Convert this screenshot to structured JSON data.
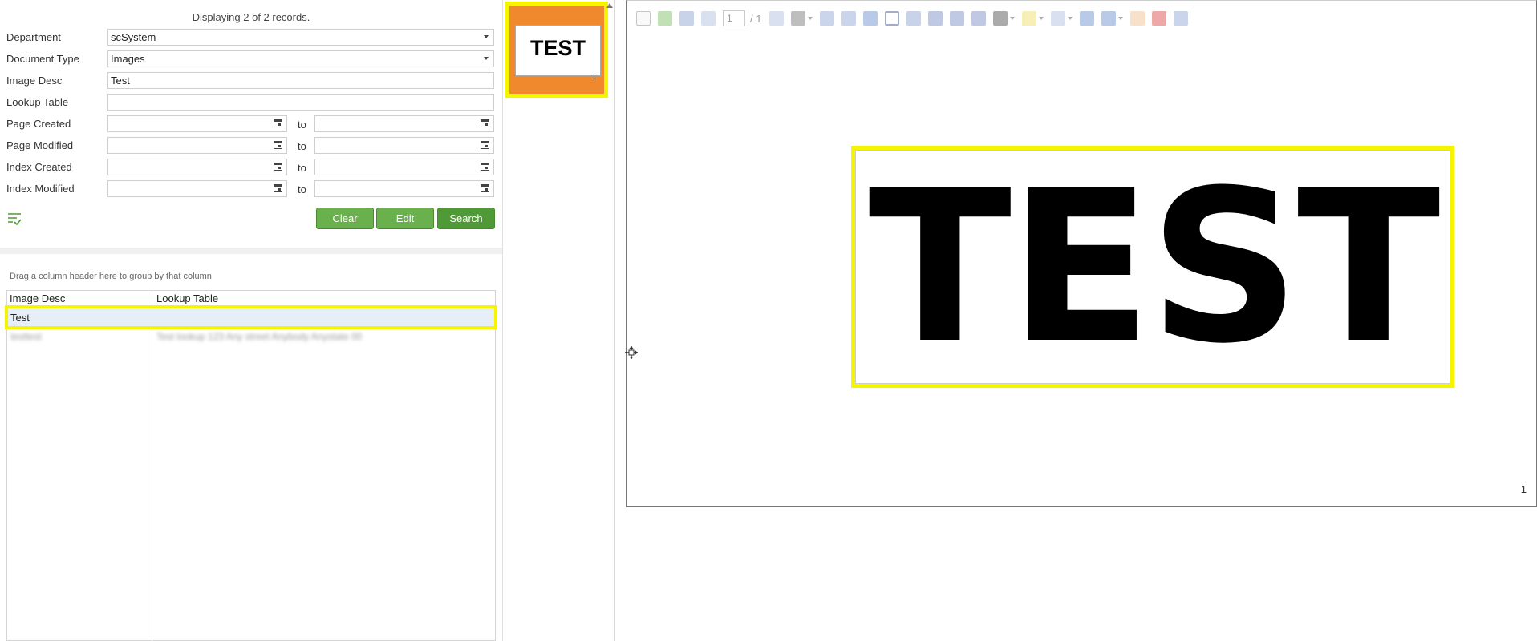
{
  "search": {
    "record_count": "Displaying 2 of 2 records.",
    "fields": {
      "department": {
        "label": "Department",
        "value": "scSystem"
      },
      "document_type": {
        "label": "Document Type",
        "value": "Images"
      },
      "image_desc": {
        "label": "Image Desc",
        "value": "Test"
      },
      "lookup_table": {
        "label": "Lookup Table",
        "value": ""
      },
      "page_created": {
        "label": "Page Created",
        "to": "to"
      },
      "page_modified": {
        "label": "Page Modified",
        "to": "to"
      },
      "index_created": {
        "label": "Index Created",
        "to": "to"
      },
      "index_modified": {
        "label": "Index Modified",
        "to": "to"
      }
    },
    "buttons": {
      "clear": "Clear",
      "edit": "Edit",
      "search": "Search"
    }
  },
  "grid": {
    "group_hint": "Drag a column header here to group by that column",
    "columns": [
      "Image Desc",
      "Lookup Table"
    ],
    "rows": [
      {
        "image_desc": "Test",
        "lookup_table": ""
      },
      {
        "image_desc": "testtest",
        "lookup_table": "Test lookup 123 Any street Anybody Anystate 00"
      }
    ]
  },
  "thumbnail": {
    "text": "TEST",
    "page": "1"
  },
  "viewer": {
    "toolbar": {
      "page_input": "1",
      "page_total": "/ 1"
    },
    "image_text": "TEST",
    "page_number": "1"
  },
  "colors": {
    "highlight": "#f5f500",
    "button_green": "#6ab04c",
    "thumb_orange": "#f0882e"
  }
}
